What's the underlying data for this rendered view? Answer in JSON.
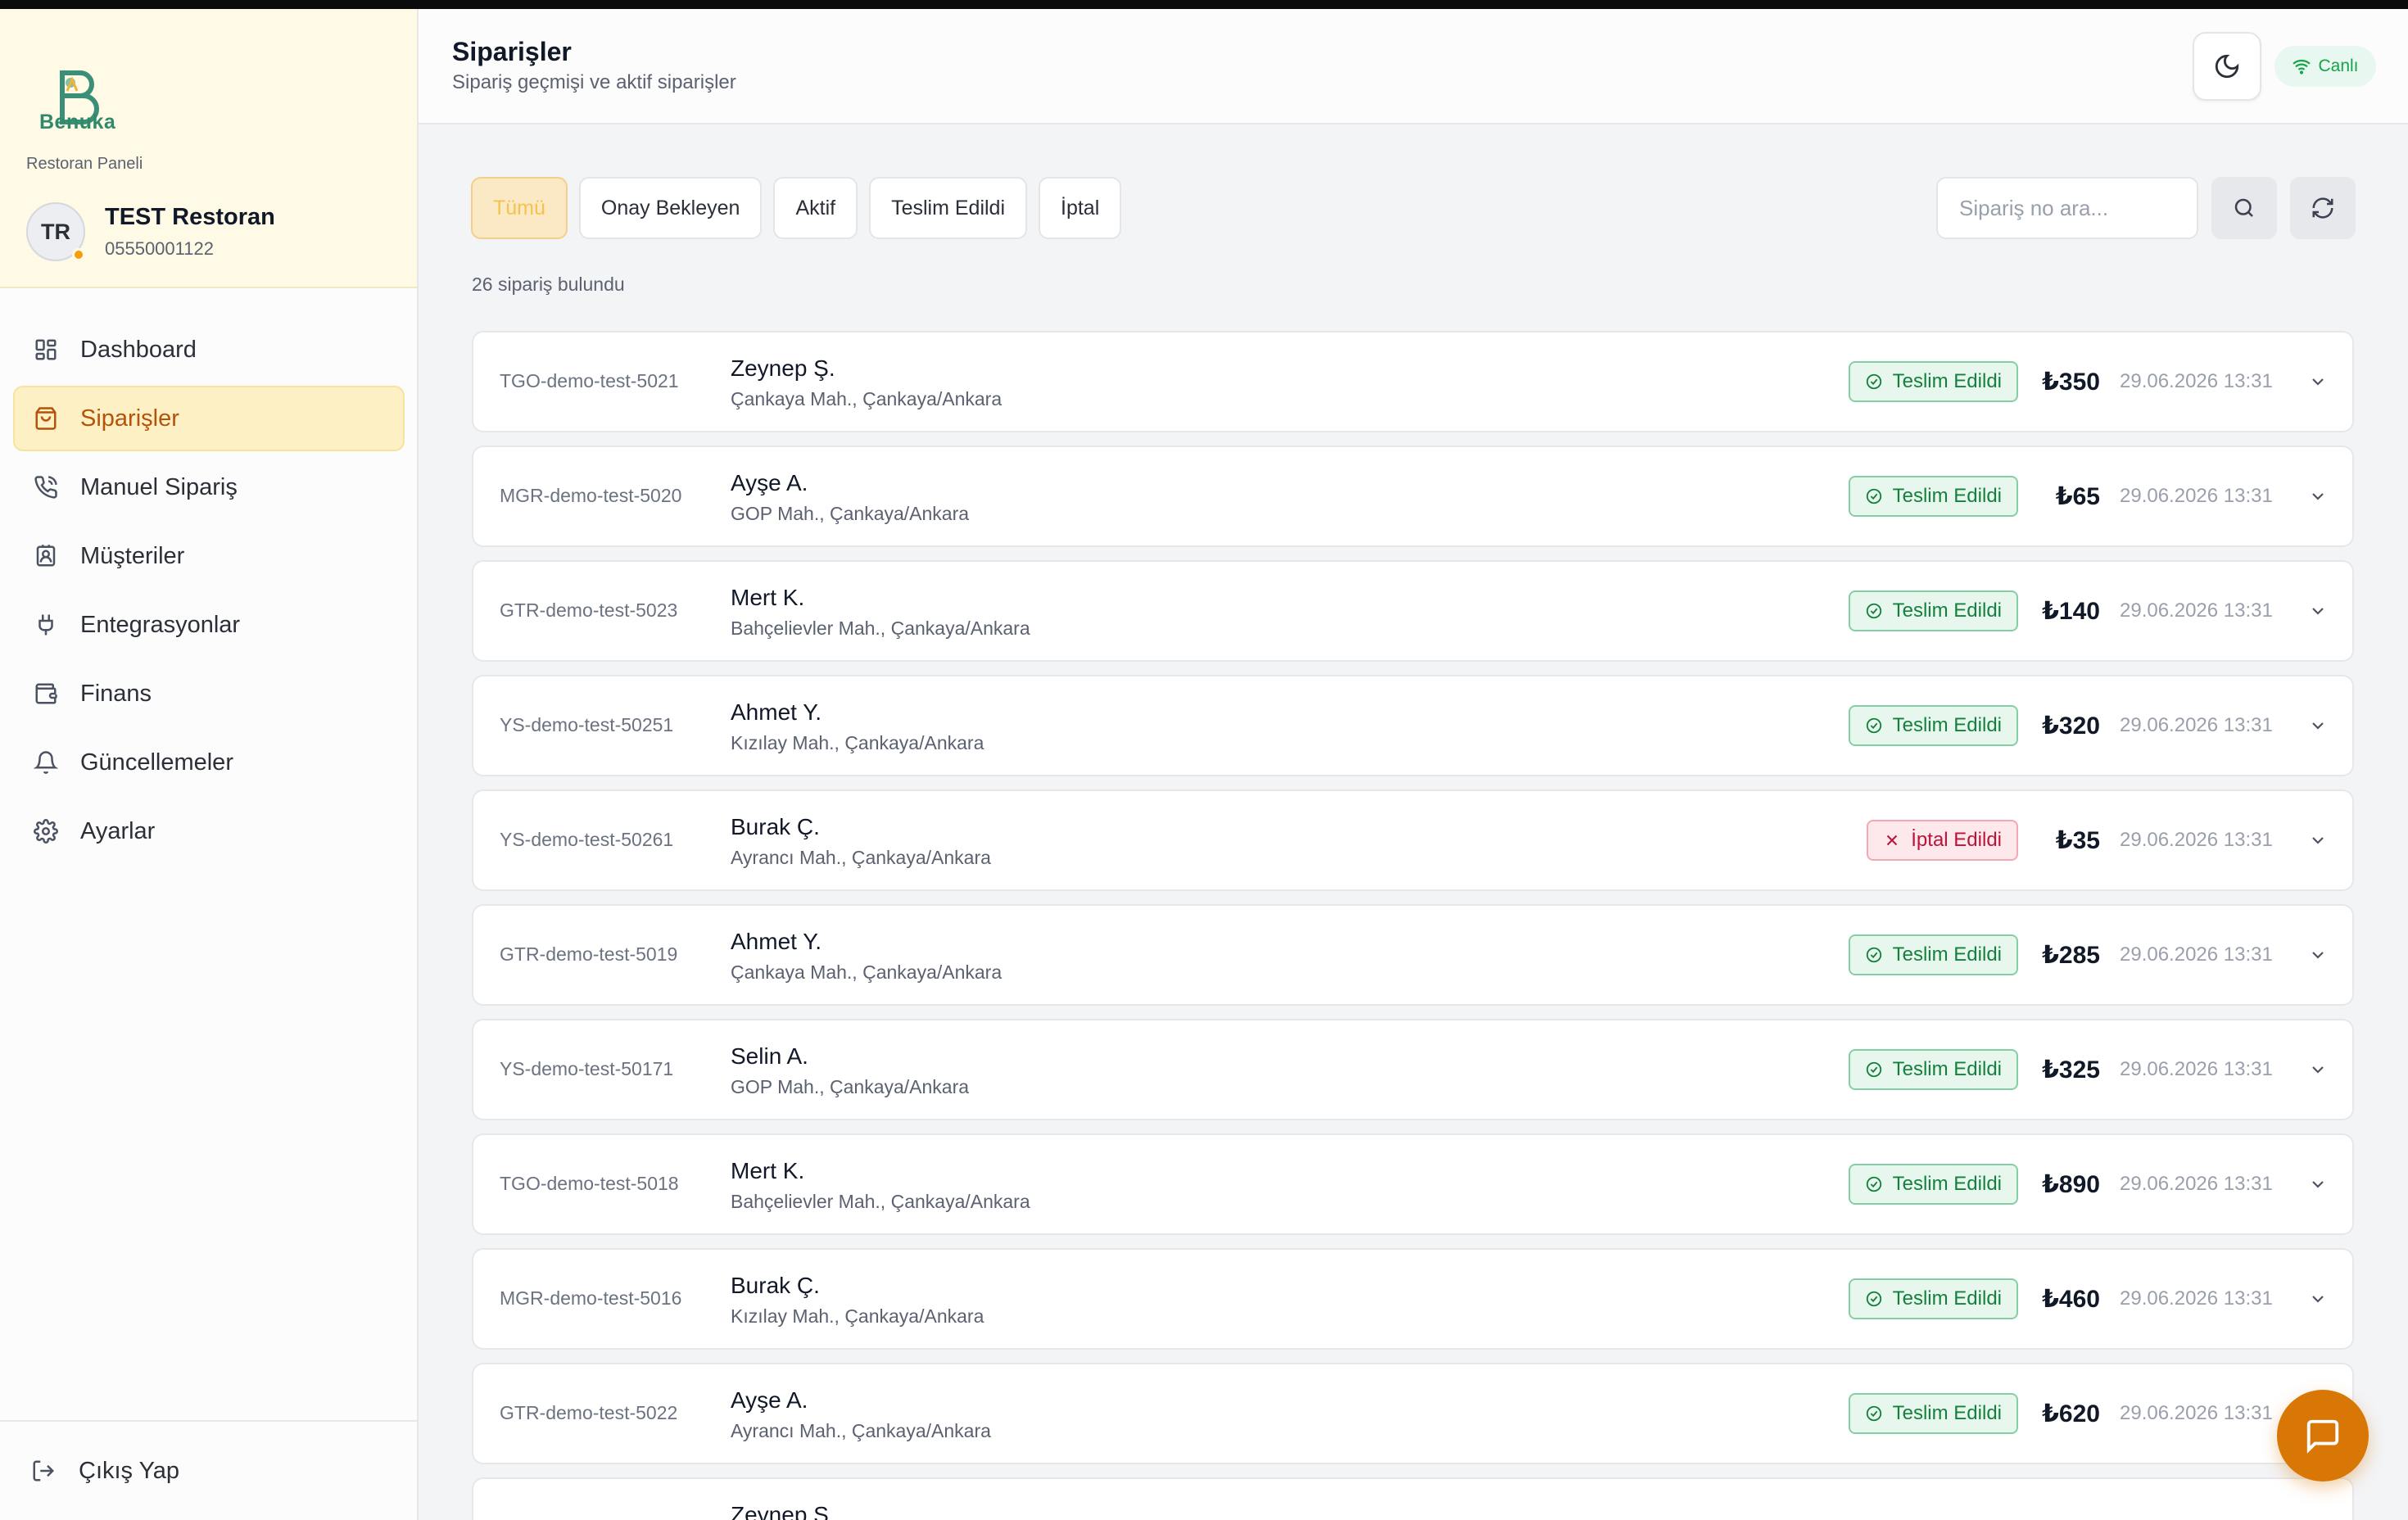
{
  "brand": {
    "logo_text": "Benuka",
    "panel_label": "Restoran Paneli",
    "avatar_initials": "TR",
    "restaurant_name": "TEST Restoran",
    "phone": "05550001122"
  },
  "nav": {
    "items": [
      {
        "label": "Dashboard",
        "icon": "dashboard-icon",
        "active": false
      },
      {
        "label": "Siparişler",
        "icon": "shopping-bag-icon",
        "active": true
      },
      {
        "label": "Manuel Sipariş",
        "icon": "phone-icon",
        "active": false
      },
      {
        "label": "Müşteriler",
        "icon": "contact-icon",
        "active": false
      },
      {
        "label": "Entegrasyonlar",
        "icon": "plug-icon",
        "active": false
      },
      {
        "label": "Finans",
        "icon": "wallet-icon",
        "active": false
      },
      {
        "label": "Güncellemeler",
        "icon": "bell-icon",
        "active": false
      },
      {
        "label": "Ayarlar",
        "icon": "gear-icon",
        "active": false
      }
    ],
    "logout_label": "Çıkış Yap"
  },
  "header": {
    "title": "Siparişler",
    "subtitle": "Sipariş geçmişi ve aktif siparişler",
    "live_label": "Canlı"
  },
  "filters": {
    "tabs": [
      "Tümü",
      "Onay Bekleyen",
      "Aktif",
      "Teslim Edildi",
      "İptal"
    ],
    "active_index": 0,
    "search_placeholder": "Sipariş no ara..."
  },
  "orders_count_text": "26 sipariş bulundu",
  "orders": [
    {
      "id": "TGO-demo-test-5021",
      "name": "Zeynep Ş.",
      "address": "Çankaya Mah., Çankaya/Ankara",
      "status": "Teslim Edildi",
      "status_type": "ok",
      "price": "₺350",
      "date": "29.06.2026 13:31"
    },
    {
      "id": "MGR-demo-test-5020",
      "name": "Ayşe A.",
      "address": "GOP Mah., Çankaya/Ankara",
      "status": "Teslim Edildi",
      "status_type": "ok",
      "price": "₺65",
      "date": "29.06.2026 13:31"
    },
    {
      "id": "GTR-demo-test-5023",
      "name": "Mert K.",
      "address": "Bahçelievler Mah., Çankaya/Ankara",
      "status": "Teslim Edildi",
      "status_type": "ok",
      "price": "₺140",
      "date": "29.06.2026 13:31"
    },
    {
      "id": "YS-demo-test-50251",
      "name": "Ahmet Y.",
      "address": "Kızılay Mah., Çankaya/Ankara",
      "status": "Teslim Edildi",
      "status_type": "ok",
      "price": "₺320",
      "date": "29.06.2026 13:31"
    },
    {
      "id": "YS-demo-test-50261",
      "name": "Burak Ç.",
      "address": "Ayrancı Mah., Çankaya/Ankara",
      "status": "İptal Edildi",
      "status_type": "cancel",
      "price": "₺35",
      "date": "29.06.2026 13:31"
    },
    {
      "id": "GTR-demo-test-5019",
      "name": "Ahmet Y.",
      "address": "Çankaya Mah., Çankaya/Ankara",
      "status": "Teslim Edildi",
      "status_type": "ok",
      "price": "₺285",
      "date": "29.06.2026 13:31"
    },
    {
      "id": "YS-demo-test-50171",
      "name": "Selin A.",
      "address": "GOP Mah., Çankaya/Ankara",
      "status": "Teslim Edildi",
      "status_type": "ok",
      "price": "₺325",
      "date": "29.06.2026 13:31"
    },
    {
      "id": "TGO-demo-test-5018",
      "name": "Mert K.",
      "address": "Bahçelievler Mah., Çankaya/Ankara",
      "status": "Teslim Edildi",
      "status_type": "ok",
      "price": "₺890",
      "date": "29.06.2026 13:31"
    },
    {
      "id": "MGR-demo-test-5016",
      "name": "Burak Ç.",
      "address": "Kızılay Mah., Çankaya/Ankara",
      "status": "Teslim Edildi",
      "status_type": "ok",
      "price": "₺460",
      "date": "29.06.2026 13:31"
    },
    {
      "id": "GTR-demo-test-5022",
      "name": "Ayşe A.",
      "address": "Ayrancı Mah., Çankaya/Ankara",
      "status": "Teslim Edildi",
      "status_type": "ok",
      "price": "₺620",
      "date": "29.06.2026 13:31"
    },
    {
      "id": "",
      "name": "Zeynep Ş.",
      "address": "",
      "status": "",
      "status_type": "ok",
      "price": "",
      "date": ""
    }
  ],
  "colors": {
    "accent": "#d97706",
    "active_nav_bg": "#fdf0c4",
    "success": "#15803d",
    "danger": "#be123c"
  }
}
